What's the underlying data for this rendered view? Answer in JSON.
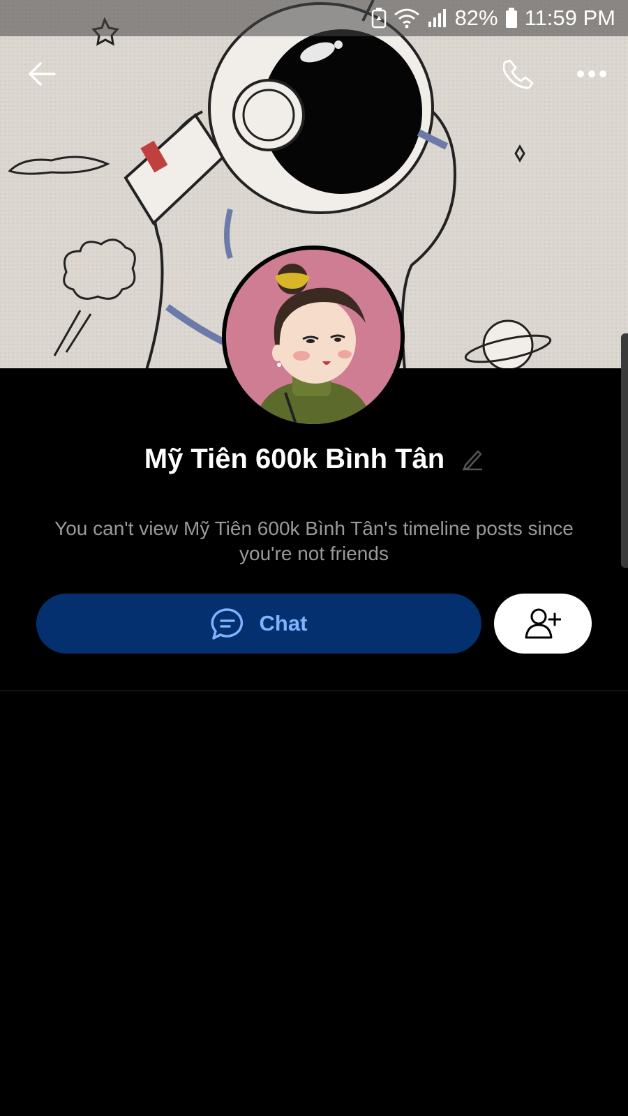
{
  "status_bar": {
    "battery_percent": "82%",
    "time": "11:59 PM",
    "icons": [
      "battery-saver-icon",
      "wifi-icon",
      "signal-icon",
      "battery-icon"
    ]
  },
  "header": {
    "back_icon": "back-arrow-icon",
    "call_icon": "phone-icon",
    "more_icon": "more-icon"
  },
  "profile": {
    "name": "Mỹ Tiên 600k Bình Tân",
    "info_message": "You can't view Mỹ Tiên 600k Bình Tân's timeline posts since you're not friends"
  },
  "actions": {
    "chat_label": "Chat",
    "chat_icon": "chat-bubble-icon",
    "add_friend_icon": "add-friend-icon"
  },
  "colors": {
    "background": "#000000",
    "chat_button_bg": "#04306f",
    "chat_button_text": "#7fb2ff",
    "info_text": "#9a9a9a"
  }
}
